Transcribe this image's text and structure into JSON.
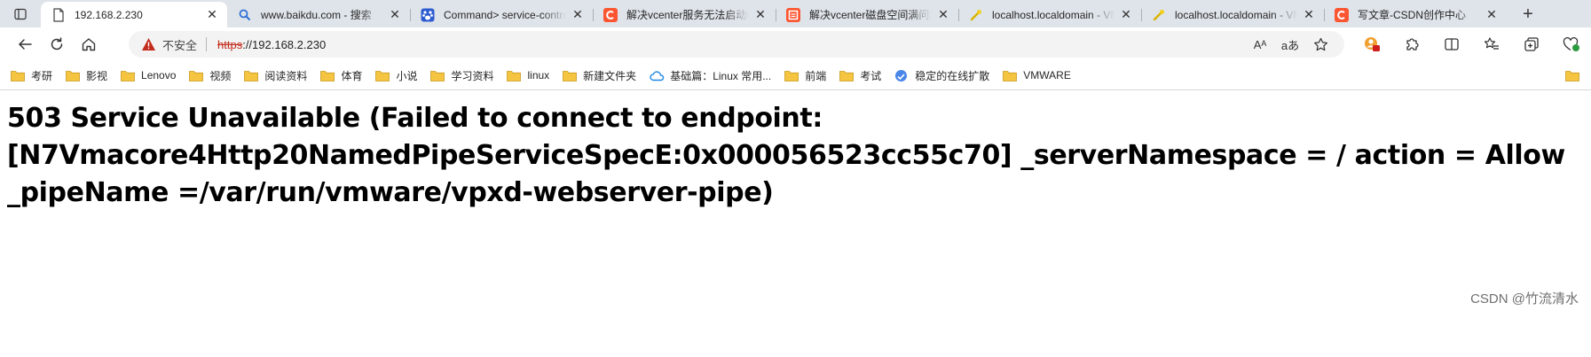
{
  "tabs": [
    {
      "title": "192.168.2.230",
      "favicon": "page-icon",
      "active": true
    },
    {
      "title": "www.baikdu.com - 搜索",
      "favicon": "search-icon"
    },
    {
      "title": "Command> service-control",
      "favicon": "baidu-paw-icon"
    },
    {
      "title": "解决vcenter服务无法启动问题",
      "favicon": "csdn-logo-icon"
    },
    {
      "title": "解决vcenter磁盘空间满问题",
      "favicon": "csdn-blog-icon"
    },
    {
      "title": "localhost.localdomain - VMware",
      "favicon": "vmware-key-icon"
    },
    {
      "title": "localhost.localdomain - VMware",
      "favicon": "vmware-key-icon"
    },
    {
      "title": "写文章-CSDN创作中心",
      "favicon": "csdn-logo-icon"
    }
  ],
  "toolbar": {
    "address": {
      "security_label": "不安全",
      "scheme": "https",
      "host": "://192.168.2.230"
    },
    "read_aloud_glyph": "Aᴬ",
    "translate_glyph": "aあ"
  },
  "bookmarks": [
    {
      "label": "考研",
      "icon": "folder-icon"
    },
    {
      "label": "影视",
      "icon": "folder-icon"
    },
    {
      "label": "Lenovo",
      "icon": "folder-icon"
    },
    {
      "label": "视频",
      "icon": "folder-icon"
    },
    {
      "label": "阅读资料",
      "icon": "folder-icon"
    },
    {
      "label": "体育",
      "icon": "folder-icon"
    },
    {
      "label": "小说",
      "icon": "folder-icon"
    },
    {
      "label": "学习资料",
      "icon": "folder-icon"
    },
    {
      "label": "linux",
      "icon": "folder-icon"
    },
    {
      "label": "新建文件夹",
      "icon": "folder-icon"
    },
    {
      "label": "基础篇：Linux 常用...",
      "icon": "cloud-icon"
    },
    {
      "label": "前端",
      "icon": "folder-icon"
    },
    {
      "label": "考试",
      "icon": "folder-icon"
    },
    {
      "label": "稳定的在线扩散",
      "icon": "globe-icon"
    },
    {
      "label": "VMWARE",
      "icon": "folder-icon"
    }
  ],
  "page": {
    "heading": "503 Service Unavailable (Failed to connect to endpoint: [N7Vmacore4Http20NamedPipeServiceSpecE:0x000056523cc55c70] _serverNamespace = / action = Allow _pipeName =/var/run/vmware/vpxd-webserver-pipe)",
    "watermark": "CSDN @竹流清水"
  },
  "colors": {
    "tabstrip_bg": "#dfe4ea",
    "insecure_red": "#c42b1c",
    "folder_yellow": "#f5c542",
    "csdn_red": "#fc5531"
  }
}
